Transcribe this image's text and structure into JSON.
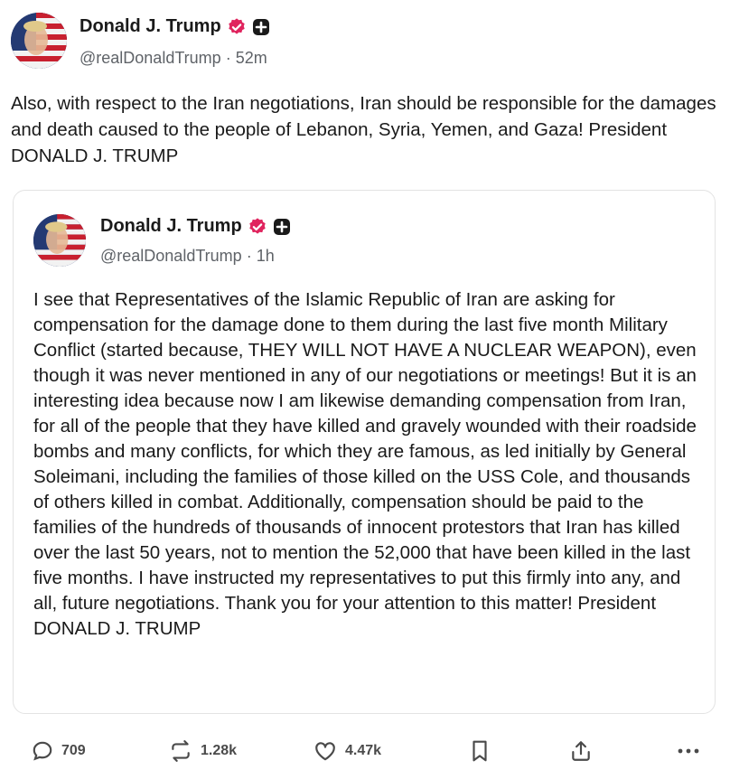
{
  "post": {
    "author_name": "Donald J. Trump",
    "handle": "@realDonaldTrump",
    "separator": "·",
    "time": "52m",
    "text": "Also, with respect to the Iran negotiations, Iran should be responsible for the damages and death caused to the people of Lebanon, Syria, Yemen, and Gaza! President DONALD J. TRUMP",
    "verified_color": "#e0245e"
  },
  "quoted_post": {
    "author_name": "Donald J. Trump",
    "handle": "@realDonaldTrump",
    "separator": "·",
    "time": "1h",
    "text": "I see that Representatives of the Islamic Republic of Iran are asking for compensation for the damage done to them during the last five month Military Conflict (started because, THEY WILL NOT HAVE A NUCLEAR WEAPON), even though it was never mentioned in any of our negotiations or meetings! But it is an interesting idea because now I am likewise demanding compensation from Iran, for all of the people that they have killed and gravely wounded with their roadside bombs and many conflicts, for which they are famous, as led initially by General Soleimani, including the families of those killed on the USS Cole, and thousands of others killed in combat. Additionally, compensation should be paid to the families of the hundreds of thousands of innocent protestors that Iran has killed over the last 50 years, not to mention the 52,000 that have been killed in the last five months. I have instructed my representatives to put this firmly into any, and all, future negotiations. Thank you for your attention to this matter! President DONALD J. TRUMP"
  },
  "actions": {
    "replies": "709",
    "reposts": "1.28k",
    "likes": "4.47k",
    "icons": [
      "reply-icon",
      "repost-icon",
      "like-icon",
      "bookmark-icon",
      "share-icon",
      "more-icon"
    ]
  }
}
